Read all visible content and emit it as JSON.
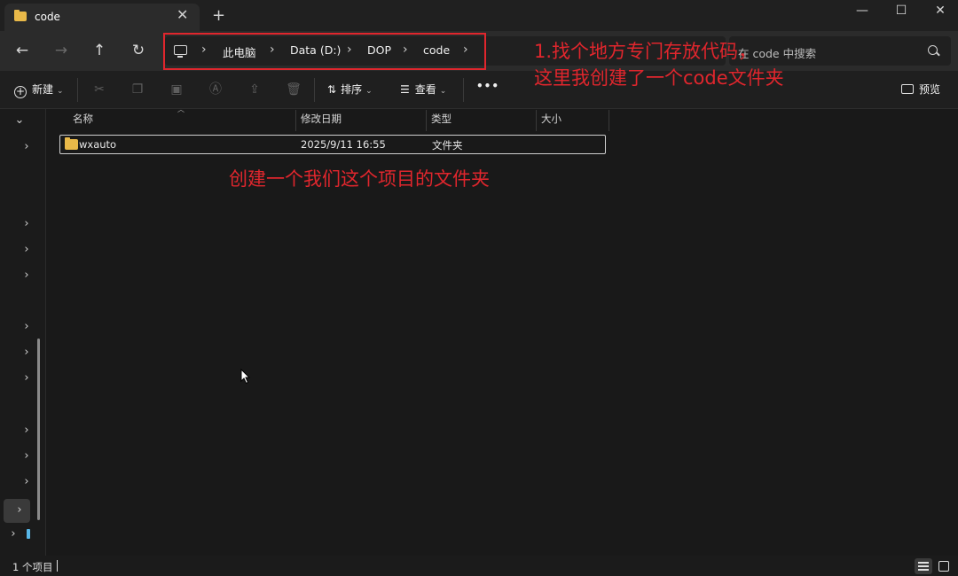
{
  "window": {
    "tab_title": "code",
    "tab_close": "✕",
    "new_tab": "+",
    "minimize": "—",
    "maximize": "☐",
    "close": "✕"
  },
  "nav": {
    "back": "←",
    "forward": "→",
    "up": "↑",
    "refresh": "↻",
    "breadcrumb": [
      "此电脑",
      "Data (D:)",
      "DOP",
      "code"
    ],
    "search_placeholder": "在 code 中搜索"
  },
  "toolbar": {
    "new_label": "新建",
    "sort_label": "排序",
    "view_label": "查看",
    "more_label": "•••",
    "preview_label": "预览"
  },
  "columns": [
    "名称",
    "修改日期",
    "类型",
    "大小"
  ],
  "files": [
    {
      "name": "wxauto",
      "modified": "2025/9/11 16:55",
      "type": "文件夹",
      "size": ""
    }
  ],
  "annotations": {
    "line1": "1.找个地方专门存放代码，",
    "line2": "这里我创建了一个code文件夹",
    "line3": "创建一个我们这个项目的文件夹"
  },
  "status": {
    "item_count": "1 个项目"
  },
  "colors": {
    "annotation_red": "#e0262d",
    "folder_yellow": "#e9b949",
    "background": "#191919"
  }
}
